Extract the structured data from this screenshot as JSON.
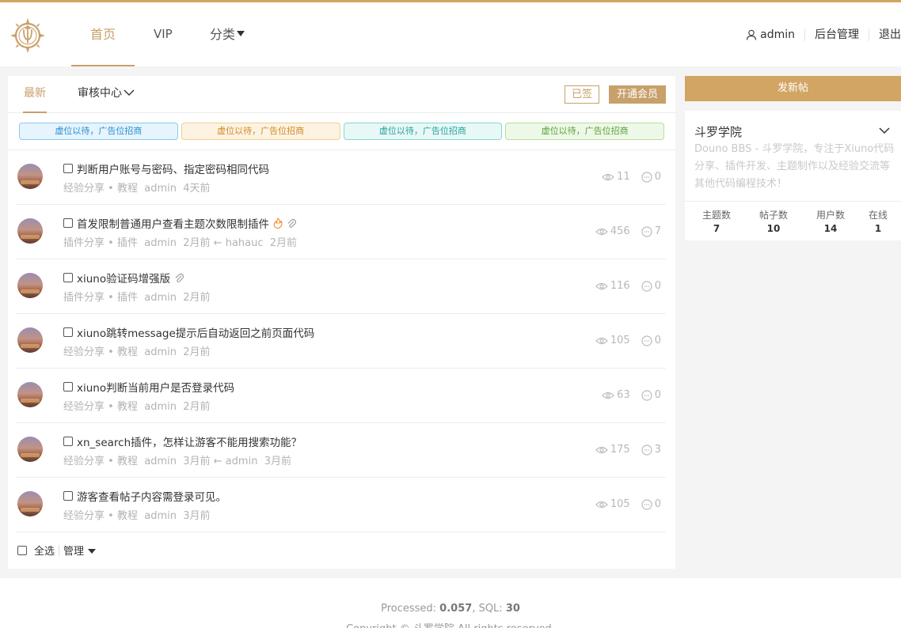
{
  "header": {
    "nav": [
      {
        "label": "首页",
        "active": true
      },
      {
        "label": "VIP"
      },
      {
        "label": "分类"
      }
    ],
    "user": {
      "name": "admin",
      "admin_link": "后台管理",
      "logout": "退出"
    },
    "accent_color": "#d2a563"
  },
  "main": {
    "tabs": [
      {
        "label": "最新",
        "active": true
      },
      {
        "label": "审核中心"
      }
    ],
    "signed_label": "已签",
    "vip_label": "开通会员",
    "ads": [
      "虚位以待，广告位招商",
      "虚位以待，广告位招商",
      "虚位以待，广告位招商",
      "虚位以待，广告位招商"
    ],
    "threads": [
      {
        "title": "判断用户账号与密码、指定密码相同代码",
        "forum": "经验分享",
        "tag": "教程",
        "author": "admin",
        "time": "4天前",
        "views": "11",
        "replies": "0"
      },
      {
        "title": "首发限制普通用户查看主题次数限制插件",
        "forum": "插件分享",
        "tag": "插件",
        "author": "admin",
        "time": "2月前",
        "last_user": "hahauc",
        "last_time": "2月前",
        "views": "456",
        "replies": "7",
        "hot": true,
        "attach": true
      },
      {
        "title": "xiuno验证码增强版",
        "forum": "插件分享",
        "tag": "插件",
        "author": "admin",
        "time": "2月前",
        "views": "116",
        "replies": "0",
        "attach": true
      },
      {
        "title": "xiuno跳转message提示后自动返回之前页面代码",
        "forum": "经验分享",
        "tag": "教程",
        "author": "admin",
        "time": "2月前",
        "views": "105",
        "replies": "0"
      },
      {
        "title": "xiuno判断当前用户是否登录代码",
        "forum": "经验分享",
        "tag": "教程",
        "author": "admin",
        "time": "2月前",
        "views": "63",
        "replies": "0"
      },
      {
        "title": "xn_search插件，怎样让游客不能用搜索功能？",
        "forum": "经验分享",
        "tag": "教程",
        "author": "admin",
        "time": "3月前",
        "last_user": "admin",
        "last_time": "3月前",
        "views": "175",
        "replies": "3"
      },
      {
        "title": "游客查看帖子内容需登录可见。",
        "forum": "经验分享",
        "tag": "教程",
        "author": "admin",
        "time": "3月前",
        "views": "105",
        "replies": "0"
      }
    ],
    "select_all": "全选",
    "manage": "管理"
  },
  "sidebar": {
    "new_post": "发新帖",
    "title": "斗罗学院",
    "description": "Douno BBS - 斗罗学院，专注于Xiuno代码分享、插件开发、主题制作以及经验交流等其他代码编程技术！",
    "stats": [
      {
        "label": "主题数",
        "value": "7"
      },
      {
        "label": "帖子数",
        "value": "10"
      },
      {
        "label": "用户数",
        "value": "14"
      },
      {
        "label": "在线",
        "value": "1"
      }
    ]
  },
  "footer": {
    "processed_label": "Processed:",
    "processed": "0.057",
    "sql_label": "SQL:",
    "sql": "30",
    "copyright": "Copyright © 斗罗学院 All rights reserved."
  }
}
